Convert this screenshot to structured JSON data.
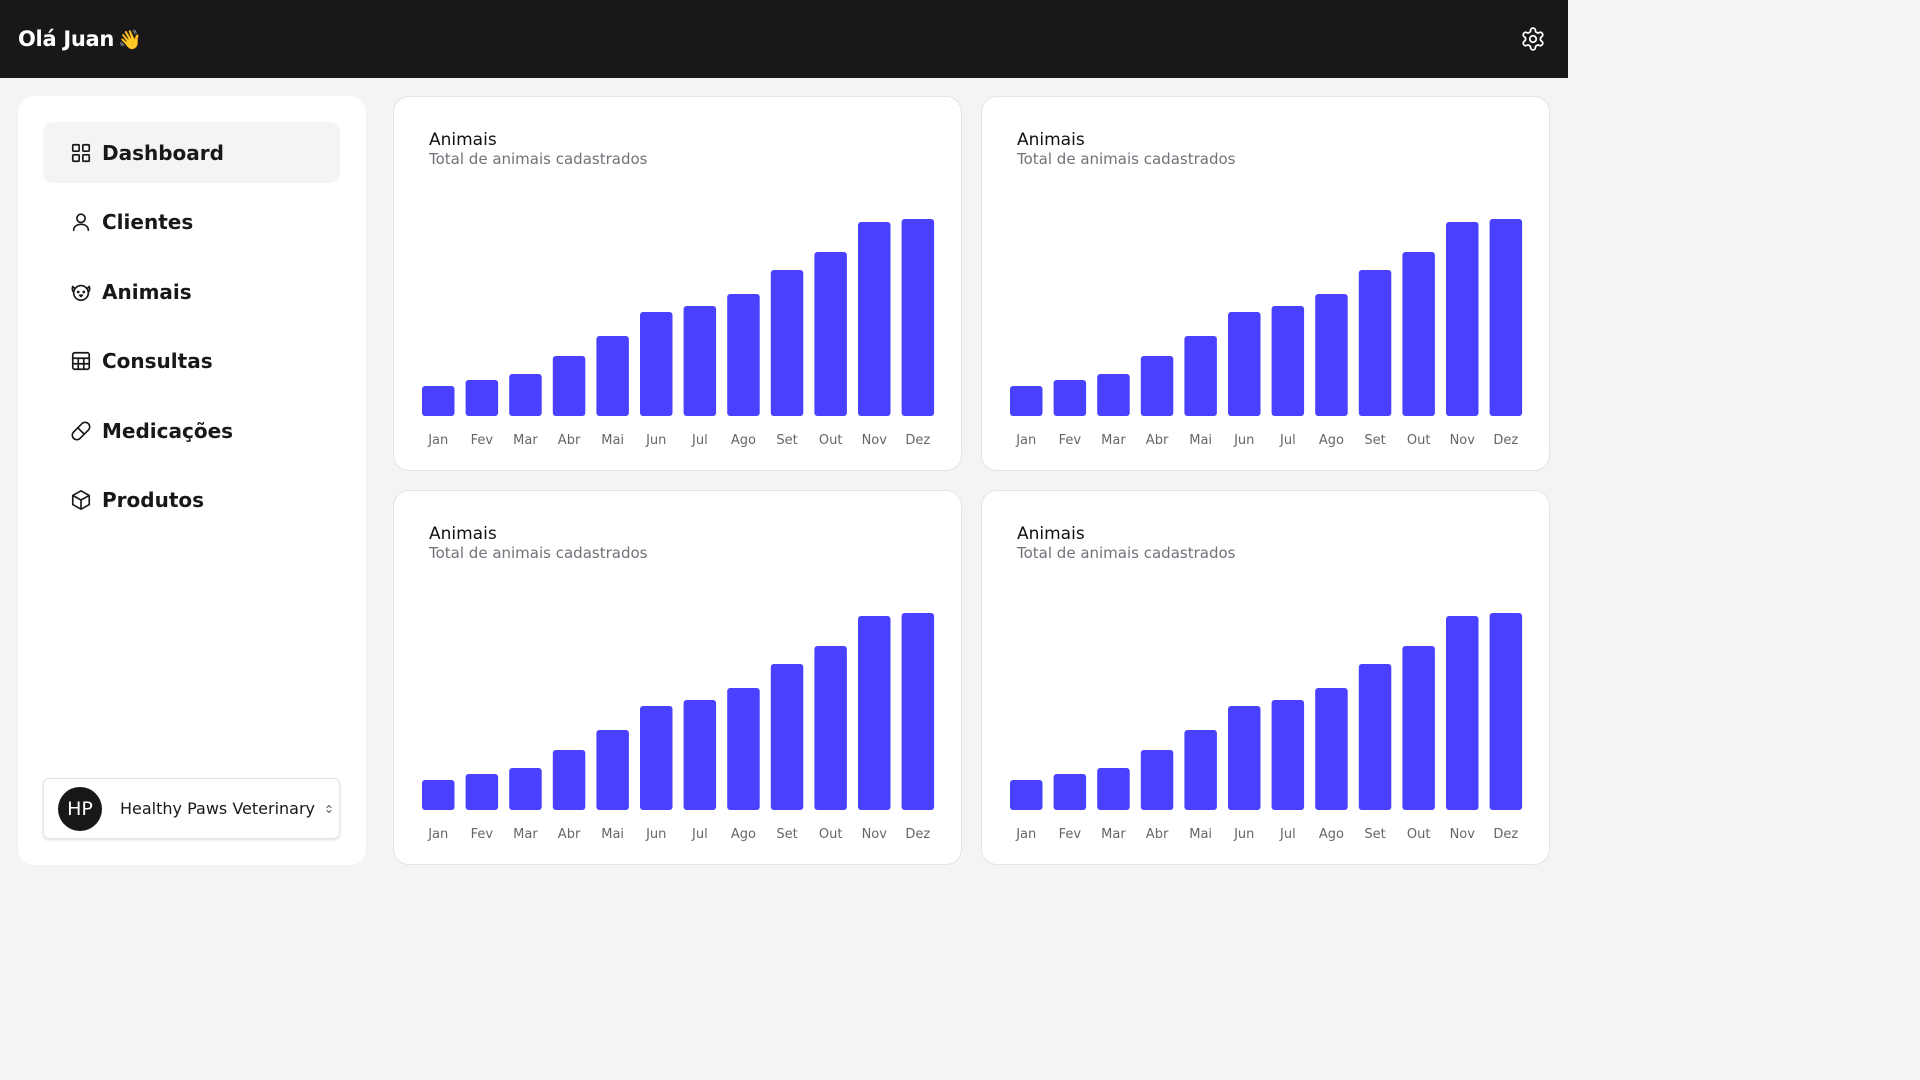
{
  "header": {
    "greeting": "Olá Juan",
    "wave_emoji": "👋",
    "settings_icon": "gear-icon"
  },
  "sidebar": {
    "items": [
      {
        "label": "Dashboard",
        "icon": "dashboard-grid-icon",
        "active": true
      },
      {
        "label": "Clientes",
        "icon": "user-icon",
        "active": false
      },
      {
        "label": "Animais",
        "icon": "dog-icon",
        "active": false
      },
      {
        "label": "Consultas",
        "icon": "table-icon",
        "active": false
      },
      {
        "label": "Medicações",
        "icon": "pill-icon",
        "active": false
      },
      {
        "label": "Produtos",
        "icon": "package-icon",
        "active": false
      }
    ],
    "clinic": {
      "initials": "HP",
      "name": "Healthy Paws Veterinary"
    }
  },
  "colors": {
    "bar": "#4a40ff",
    "header_bg": "#18181b",
    "page_bg": "#f4f4f5"
  },
  "cards": [
    {
      "title": "Animais",
      "subtitle": "Total de animais cadastrados"
    },
    {
      "title": "Animais",
      "subtitle": "Total de animais cadastrados"
    },
    {
      "title": "Animais",
      "subtitle": "Total de animais cadastrados"
    },
    {
      "title": "Animais",
      "subtitle": "Total de animais cadastrados"
    }
  ],
  "chart_data": [
    {
      "type": "bar",
      "title": "Animais",
      "subtitle": "Total de animais cadastrados",
      "categories": [
        "Jan",
        "Fev",
        "Mar",
        "Abr",
        "Mai",
        "Jun",
        "Jul",
        "Ago",
        "Set",
        "Out",
        "Nov",
        "Dez"
      ],
      "values": [
        30,
        36,
        42,
        60,
        80,
        104,
        110,
        122,
        146,
        164,
        194,
        197
      ],
      "ylim": [
        0,
        200
      ],
      "grid": false
    },
    {
      "type": "bar",
      "title": "Animais",
      "subtitle": "Total de animais cadastrados",
      "categories": [
        "Jan",
        "Fev",
        "Mar",
        "Abr",
        "Mai",
        "Jun",
        "Jul",
        "Ago",
        "Set",
        "Out",
        "Nov",
        "Dez"
      ],
      "values": [
        30,
        36,
        42,
        60,
        80,
        104,
        110,
        122,
        146,
        164,
        194,
        197
      ],
      "ylim": [
        0,
        200
      ],
      "grid": false
    },
    {
      "type": "bar",
      "title": "Animais",
      "subtitle": "Total de animais cadastrados",
      "categories": [
        "Jan",
        "Fev",
        "Mar",
        "Abr",
        "Mai",
        "Jun",
        "Jul",
        "Ago",
        "Set",
        "Out",
        "Nov",
        "Dez"
      ],
      "values": [
        30,
        36,
        42,
        60,
        80,
        104,
        110,
        122,
        146,
        164,
        194,
        197
      ],
      "ylim": [
        0,
        200
      ],
      "grid": false
    },
    {
      "type": "bar",
      "title": "Animais",
      "subtitle": "Total de animais cadastrados",
      "categories": [
        "Jan",
        "Fev",
        "Mar",
        "Abr",
        "Mai",
        "Jun",
        "Jul",
        "Ago",
        "Set",
        "Out",
        "Nov",
        "Dez"
      ],
      "values": [
        30,
        36,
        42,
        60,
        80,
        104,
        110,
        122,
        146,
        164,
        194,
        197
      ],
      "ylim": [
        0,
        200
      ],
      "grid": false
    }
  ]
}
